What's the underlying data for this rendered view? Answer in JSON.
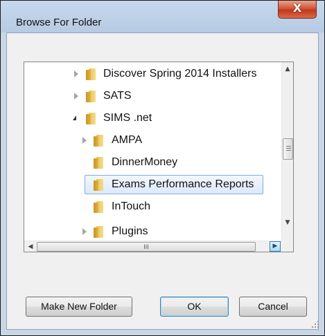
{
  "window": {
    "title": "Browse For Folder",
    "close_glyph": "X"
  },
  "tree": {
    "items": [
      {
        "label": "Discover Spring 2014 Installers",
        "state": "collapsed"
      },
      {
        "label": "SATS",
        "state": "collapsed"
      },
      {
        "label": "SIMS .net",
        "state": "expanded"
      },
      {
        "label": "AMPA",
        "state": "collapsed"
      },
      {
        "label": "DinnerMoney",
        "state": "leaf"
      },
      {
        "label": "Exams Performance Reports",
        "state": "selected"
      },
      {
        "label": "InTouch",
        "state": "leaf"
      },
      {
        "label": "Plugins",
        "state": "collapsed"
      }
    ]
  },
  "scrollbars": {
    "up": "▲",
    "down": "▼",
    "left": "◀",
    "right": "▶",
    "h_grip": "III"
  },
  "buttons": {
    "make_new_folder": "Make New Folder",
    "ok": "OK",
    "cancel": "Cancel"
  },
  "colors": {
    "selection_border": "#84acdd",
    "close_button": "#c2381b",
    "title_bar": "#c6d8ec"
  }
}
